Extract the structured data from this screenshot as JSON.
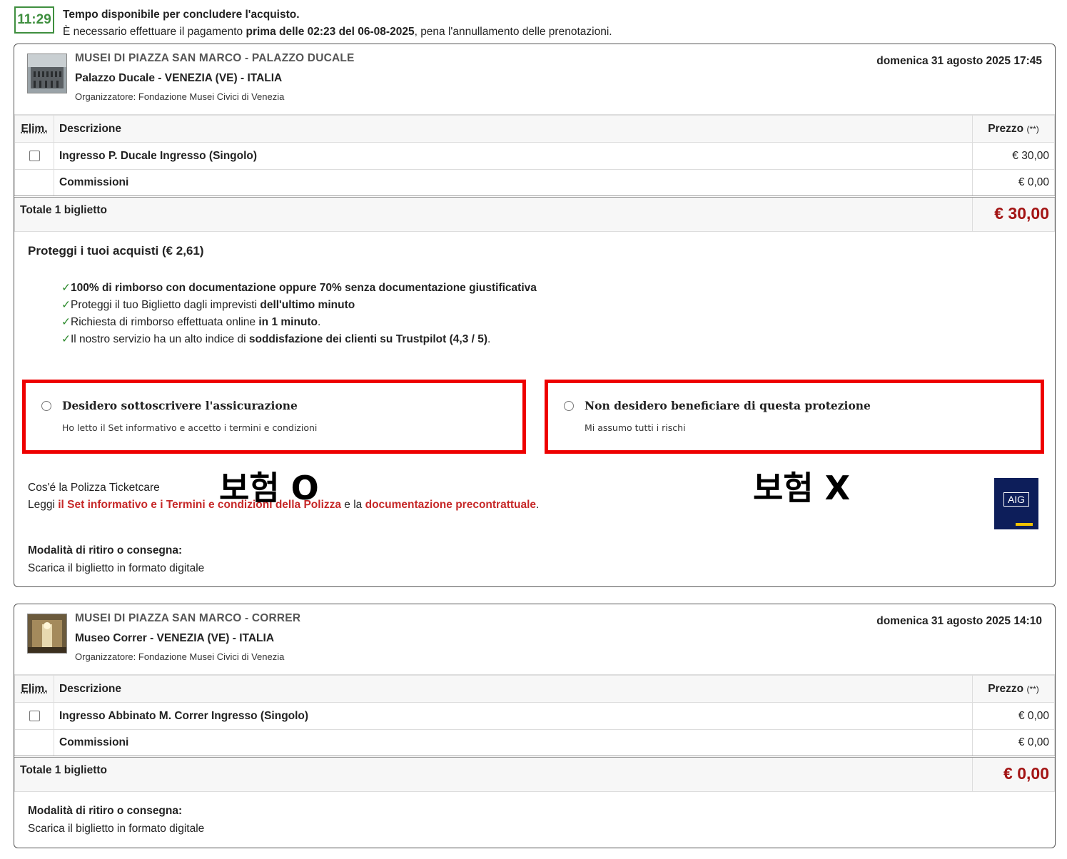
{
  "timer": {
    "value": "11:29",
    "line1": "Tempo disponibile per concludere l'acquisto.",
    "line2_pre": "È necessario effettuare il pagamento ",
    "line2_bold": "prima delle 02:23 del 06-08-2025",
    "line2_post": ", pena l'annullamento delle prenotazioni."
  },
  "events": [
    {
      "title": "MUSEI DI PIAZZA SAN MARCO - PALAZZO DUCALE",
      "venue": "Palazzo Ducale - VENEZIA (VE) - ITALIA",
      "organizer": "Organizzatore: Fondazione Musei Civici di Venezia",
      "date": "domenica 31 agosto 2025 17:45",
      "ticket": "Ingresso P. Ducale Ingresso (Singolo)",
      "ticket_price": "€ 30,00",
      "fees_label": "Commissioni",
      "fees_price": "€ 0,00",
      "total_label": "Totale 1 biglietto",
      "total_price": "€ 30,00"
    },
    {
      "title": "MUSEI DI PIAZZA SAN MARCO - CORRER",
      "venue": "Museo Correr - VENEZIA (VE) - ITALIA",
      "organizer": "Organizzatore: Fondazione Musei Civici di Venezia",
      "date": "domenica 31 agosto 2025 14:10",
      "ticket": "Ingresso Abbinato M. Correr Ingresso (Singolo)",
      "ticket_price": "€ 0,00",
      "fees_label": "Commissioni",
      "fees_price": "€ 0,00",
      "total_label": "Totale 1 biglietto",
      "total_price": "€ 0,00"
    }
  ],
  "table_header": {
    "del": "Elim.",
    "desc": "Descrizione",
    "price": "Prezzo",
    "price_note": "(**)"
  },
  "insurance": {
    "title": "Proteggi i tuoi acquisti (€ 2,61)",
    "bullets": [
      {
        "check": "✓",
        "pre": "",
        "bold": "100% di rimborso con documentazione oppure 70% senza documentazione giustificativa",
        "post": ""
      },
      {
        "check": "✓",
        "pre": "Proteggi il tuo Biglietto dagli imprevisti ",
        "bold": "dell'ultimo minuto",
        "post": ""
      },
      {
        "check": "✓",
        "pre": "Richiesta di rimborso effettuata online ",
        "bold": "in 1 minuto",
        "post": "."
      },
      {
        "check": "✓",
        "pre": "Il nostro servizio ha un alto indice di ",
        "bold": "soddisfazione dei clienti su Trustpilot (4,3 / 5)",
        "post": "."
      }
    ],
    "option_yes_title": "Desidero sottoscrivere l'assicurazione",
    "option_yes_sub": "Ho letto il Set informativo e accetto i termini e condizioni",
    "option_no_title": "Non desidero beneficiare di questa protezione",
    "option_no_sub": "Mi assumo tutti i rischi",
    "annot_yes": "보험 O",
    "annot_no": "보험 X",
    "policy_q": "Cos'é la Polizza Ticketcare",
    "policy_pre": "Leggi ",
    "policy_link1": "il Set informativo e i Termini e condizioni della Polizza",
    "policy_mid": " e la ",
    "policy_link2": "documentazione precontrattuale",
    "policy_post": ".",
    "aig_logo": "AIG"
  },
  "delivery": {
    "heading": "Modalità di ritiro o consegna:",
    "text": "Scarica il biglietto in formato digitale"
  },
  "colors": {
    "accent_red": "#a31515",
    "timer_green": "#3f8f3f",
    "highlight_red": "#ee0000",
    "link_red": "#c62828"
  }
}
